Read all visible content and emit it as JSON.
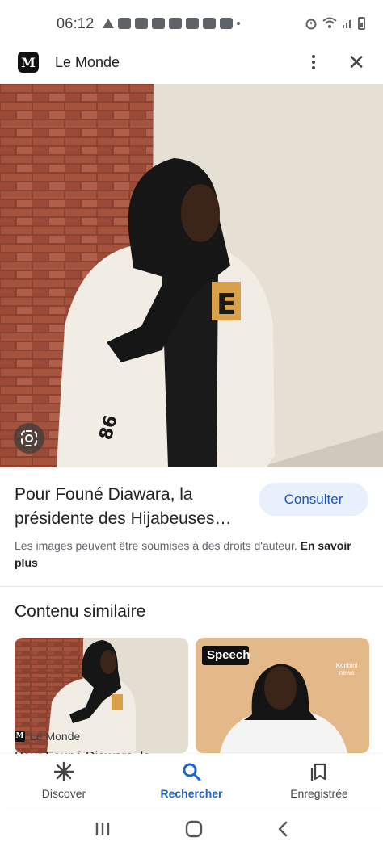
{
  "status_bar": {
    "time": "06:12"
  },
  "header": {
    "source_name": "Le Monde",
    "logo_letter": "M"
  },
  "result": {
    "title": "Pour Founé Diawara, la présidente des Hijabeuses…",
    "open_button": "Consulter",
    "copyright_text": "Les images peuvent être soumises à des droits d'auteur.",
    "learn_more": "En savoir plus"
  },
  "similar": {
    "section_title": "Contenu similaire",
    "items": [
      {
        "source": "Le Monde",
        "title": "Pour Founé Diawara, la"
      },
      {
        "badge": "Speech",
        "brand": "Konbini news"
      }
    ]
  },
  "bottom_nav": {
    "items": [
      {
        "label": "Discover",
        "icon": "asterisk-icon"
      },
      {
        "label": "Rechercher",
        "icon": "search-icon"
      },
      {
        "label": "Enregistrée",
        "icon": "bookmarks-icon"
      }
    ],
    "active": "Rechercher"
  },
  "colors": {
    "accent": "#1a63d1",
    "button_bg": "#e8f0fe"
  }
}
